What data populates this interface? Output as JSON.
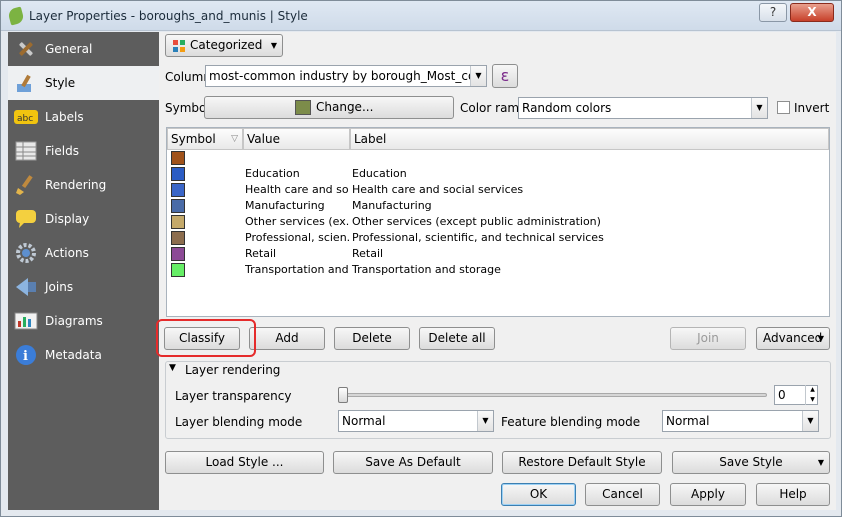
{
  "window": {
    "title": "Layer Properties - boroughs_and_munis | Style",
    "help_label": "?",
    "close_label": "X"
  },
  "sidebar": {
    "items": [
      {
        "label": "General",
        "icon": "tools-icon"
      },
      {
        "label": "Style",
        "icon": "paintbrush-icon"
      },
      {
        "label": "Labels",
        "icon": "abc-labels-icon"
      },
      {
        "label": "Fields",
        "icon": "table-icon"
      },
      {
        "label": "Rendering",
        "icon": "brush-icon"
      },
      {
        "label": "Display",
        "icon": "speech-bubble-icon"
      },
      {
        "label": "Actions",
        "icon": "gear-icon"
      },
      {
        "label": "Joins",
        "icon": "join-arrow-icon"
      },
      {
        "label": "Diagrams",
        "icon": "diagram-icon"
      },
      {
        "label": "Metadata",
        "icon": "info-icon"
      }
    ],
    "active": "Style"
  },
  "style": {
    "renderer": "Categorized",
    "column_label": "Column",
    "column_value": "most-common industry by borough_Most_common",
    "expression_label": "ε",
    "symbol_label": "Symbol",
    "symbol_button": "Change...",
    "symbol_color": "#7c8c4a",
    "color_ramp_label": "Color ramp",
    "color_ramp_value": "Random colors",
    "invert_label": "Invert"
  },
  "table": {
    "headers": [
      "Symbol",
      "Value",
      "Label"
    ],
    "rows": [
      {
        "color": "#a0521a",
        "value": "",
        "label": ""
      },
      {
        "color": "#2b5cc4",
        "value": "Education",
        "label": "Education"
      },
      {
        "color": "#3a66c8",
        "value": "Health care and so...",
        "label": "Health care and social services"
      },
      {
        "color": "#4a6ba7",
        "value": "Manufacturing",
        "label": "Manufacturing"
      },
      {
        "color": "#c4a96a",
        "value": "Other services (ex...",
        "label": "Other services (except public administration)"
      },
      {
        "color": "#8c6d4e",
        "value": "Professional, scien...",
        "label": "Professional, scientific, and technical services"
      },
      {
        "color": "#8c4a96",
        "value": "Retail",
        "label": "Retail"
      },
      {
        "color": "#66ee66",
        "value": "Transportation and...",
        "label": "Transportation and storage"
      }
    ]
  },
  "actions": {
    "classify": "Classify",
    "add": "Add",
    "delete": "Delete",
    "delete_all": "Delete all",
    "join": "Join",
    "advanced": "Advanced"
  },
  "layer_rendering": {
    "title": "Layer rendering",
    "transparency_label": "Layer transparency",
    "transparency_value": "0",
    "blending_label": "Layer blending mode",
    "blending_value": "Normal",
    "feature_blending_label": "Feature blending mode",
    "feature_blending_value": "Normal"
  },
  "bottom": {
    "load_style": "Load Style ...",
    "save_default": "Save As Default",
    "restore_default": "Restore Default Style",
    "save_style": "Save Style",
    "ok": "OK",
    "cancel": "Cancel",
    "apply": "Apply",
    "help": "Help"
  }
}
